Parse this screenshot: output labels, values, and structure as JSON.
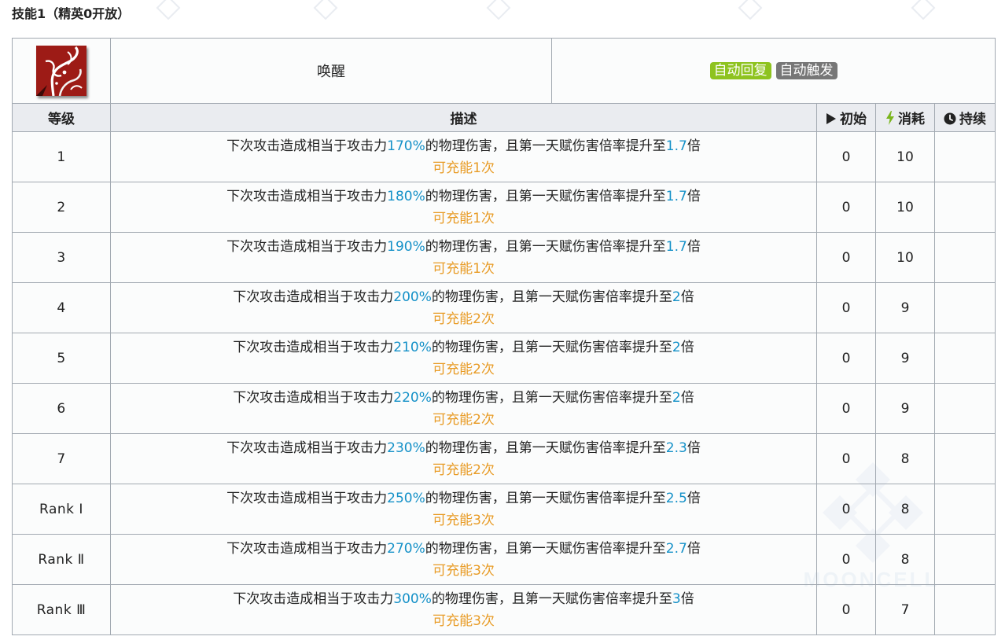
{
  "section_title": "技能1（精英0开放）",
  "skill": {
    "icon": "skill-icon-red-tendrils",
    "name": "唤醒",
    "tags": [
      {
        "label": "自动回复",
        "color": "#8ec31f"
      },
      {
        "label": "自动触发",
        "color": "#777777"
      }
    ]
  },
  "columns": {
    "level": "等级",
    "description": "描述",
    "initial": "初始",
    "cost": "消耗",
    "duration": "持续"
  },
  "rows": [
    {
      "level": "1",
      "d1": "下次攻击造成相当于攻击力",
      "atk": "170%",
      "d2": "的物理伤害，且第一天赋伤害倍率提升至",
      "mult": "1.7",
      "d3": "倍",
      "charge": "可充能1次",
      "initial": "0",
      "cost": "10",
      "duration": ""
    },
    {
      "level": "2",
      "d1": "下次攻击造成相当于攻击力",
      "atk": "180%",
      "d2": "的物理伤害，且第一天赋伤害倍率提升至",
      "mult": "1.7",
      "d3": "倍",
      "charge": "可充能1次",
      "initial": "0",
      "cost": "10",
      "duration": ""
    },
    {
      "level": "3",
      "d1": "下次攻击造成相当于攻击力",
      "atk": "190%",
      "d2": "的物理伤害，且第一天赋伤害倍率提升至",
      "mult": "1.7",
      "d3": "倍",
      "charge": "可充能1次",
      "initial": "0",
      "cost": "10",
      "duration": ""
    },
    {
      "level": "4",
      "d1": "下次攻击造成相当于攻击力",
      "atk": "200%",
      "d2": "的物理伤害，且第一天赋伤害倍率提升至",
      "mult": "2",
      "d3": "倍",
      "charge": "可充能2次",
      "initial": "0",
      "cost": "9",
      "duration": ""
    },
    {
      "level": "5",
      "d1": "下次攻击造成相当于攻击力",
      "atk": "210%",
      "d2": "的物理伤害，且第一天赋伤害倍率提升至",
      "mult": "2",
      "d3": "倍",
      "charge": "可充能2次",
      "initial": "0",
      "cost": "9",
      "duration": ""
    },
    {
      "level": "6",
      "d1": "下次攻击造成相当于攻击力",
      "atk": "220%",
      "d2": "的物理伤害，且第一天赋伤害倍率提升至",
      "mult": "2",
      "d3": "倍",
      "charge": "可充能2次",
      "initial": "0",
      "cost": "9",
      "duration": ""
    },
    {
      "level": "7",
      "d1": "下次攻击造成相当于攻击力",
      "atk": "230%",
      "d2": "的物理伤害，且第一天赋伤害倍率提升至",
      "mult": "2.3",
      "d3": "倍",
      "charge": "可充能2次",
      "initial": "0",
      "cost": "8",
      "duration": ""
    },
    {
      "level": "Rank Ⅰ",
      "d1": "下次攻击造成相当于攻击力",
      "atk": "250%",
      "d2": "的物理伤害，且第一天赋伤害倍率提升至",
      "mult": "2.5",
      "d3": "倍",
      "charge": "可充能3次",
      "initial": "0",
      "cost": "8",
      "duration": ""
    },
    {
      "level": "Rank Ⅱ",
      "d1": "下次攻击造成相当于攻击力",
      "atk": "270%",
      "d2": "的物理伤害，且第一天赋伤害倍率提升至",
      "mult": "2.7",
      "d3": "倍",
      "charge": "可充能3次",
      "initial": "0",
      "cost": "8",
      "duration": ""
    },
    {
      "level": "Rank Ⅲ",
      "d1": "下次攻击造成相当于攻击力",
      "atk": "300%",
      "d2": "的物理伤害，且第一天赋伤害倍率提升至",
      "mult": "3",
      "d3": "倍",
      "charge": "可充能3次",
      "initial": "0",
      "cost": "7",
      "duration": ""
    }
  ],
  "watermark": "MOONCELL",
  "colors": {
    "highlight": "#1591c8",
    "charge": "#e89b25",
    "header_bg": "#eaecf0",
    "border": "#a2a9b1",
    "cost_icon": "#7ab51d"
  }
}
